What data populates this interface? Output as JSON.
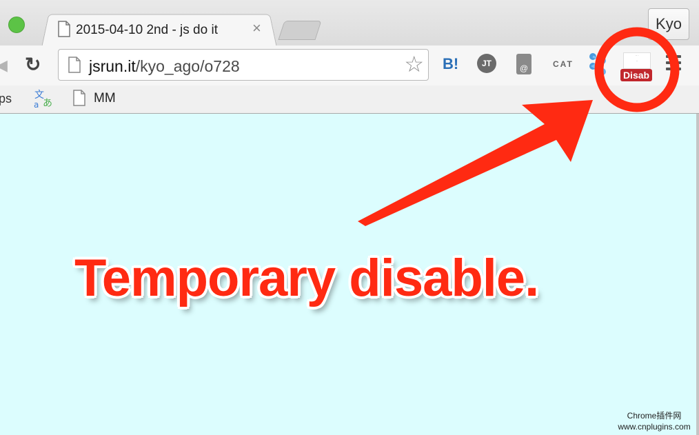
{
  "browser": {
    "tab": {
      "title": "2015-04-10 2nd - js do it",
      "close_glyph": "×"
    },
    "profile_label": "Kyo",
    "address_bar": {
      "host": "jsrun.it",
      "path": "/kyo_ago/o728"
    },
    "extensions": {
      "hatena_label": "B!",
      "jt_label": "JT",
      "mail_label": "@",
      "cat_label": "CAT",
      "disable_badge": "Disab"
    },
    "bookmarks": {
      "apps_label": "ps",
      "item_label": "MM"
    }
  },
  "annotation": {
    "headline": "Temporary disable.",
    "accent_color": "#ff2a12"
  },
  "watermark": {
    "line1": "Chrome插件网",
    "line2": "www.cnplugins.com"
  }
}
